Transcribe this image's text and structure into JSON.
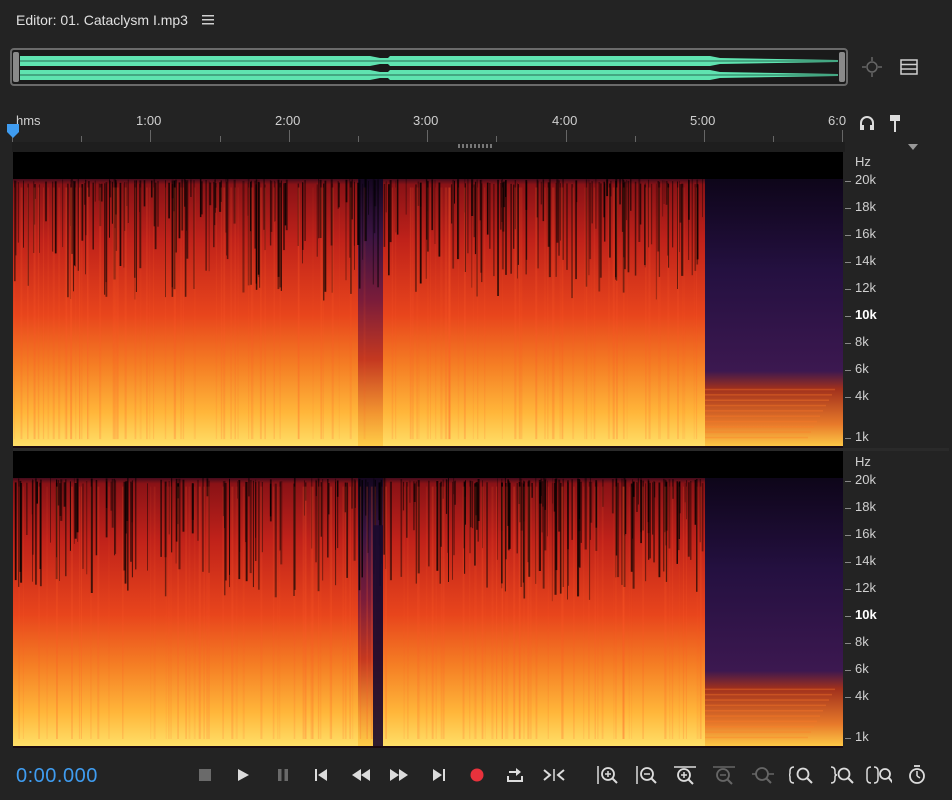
{
  "panel": {
    "title": "Editor: 01. Cataclysm I.mp3",
    "menu_icon": "hamburger-menu-icon"
  },
  "ruler": {
    "unit_label": "hms",
    "time_labels": [
      "1:00",
      "2:00",
      "3:00",
      "4:00",
      "5:00",
      "6:0"
    ]
  },
  "spectrogram": {
    "unit_label": "Hz",
    "channels": [
      {
        "name": "channel-1",
        "freq_labels": [
          "20k",
          "18k",
          "16k",
          "14k",
          "12k",
          "10k",
          "8k",
          "6k",
          "4k",
          "1k"
        ]
      },
      {
        "name": "channel-2",
        "freq_labels": [
          "20k",
          "18k",
          "16k",
          "14k",
          "12k",
          "10k",
          "8k",
          "6k",
          "4k",
          "1k"
        ]
      }
    ]
  },
  "transport": {
    "timecode": "0:00.000",
    "buttons": [
      {
        "name": "stop-button",
        "icon": "stop-icon"
      },
      {
        "name": "play-button",
        "icon": "play-icon"
      },
      {
        "name": "pause-button",
        "icon": "pause-icon"
      },
      {
        "name": "skip-to-start-button",
        "icon": "skip-back-icon"
      },
      {
        "name": "rewind-button",
        "icon": "rewind-icon"
      },
      {
        "name": "fast-forward-button",
        "icon": "fast-forward-icon"
      },
      {
        "name": "skip-to-end-button",
        "icon": "skip-forward-icon"
      },
      {
        "name": "record-button",
        "icon": "record-icon"
      },
      {
        "name": "loop-playback-button",
        "icon": "loop-icon"
      },
      {
        "name": "skip-selection-button",
        "icon": "skip-selection-icon"
      },
      {
        "name": "zoom-in-amplitude-button",
        "icon": "zoom-in-amplitude-icon"
      },
      {
        "name": "zoom-out-amplitude-button",
        "icon": "zoom-out-amplitude-icon"
      },
      {
        "name": "zoom-in-time-button",
        "icon": "zoom-in-time-icon"
      },
      {
        "name": "zoom-out-full-button",
        "icon": "zoom-out-full-icon"
      },
      {
        "name": "zoom-in-selection-button",
        "icon": "zoom-selection-icon"
      },
      {
        "name": "zoom-in-left-button",
        "icon": "zoom-left-icon"
      },
      {
        "name": "zoom-in-right-button",
        "icon": "zoom-right-icon"
      },
      {
        "name": "zoom-both-button",
        "icon": "zoom-both-icon"
      },
      {
        "name": "zoom-reset-button",
        "icon": "zoom-reset-icon"
      }
    ]
  },
  "colors": {
    "accent": "#3f9cf0",
    "waveform": "#5fe3b0",
    "record": "#e8323c",
    "spectro_low": "#1a0a2e",
    "spectro_mid": "#c81f14",
    "spectro_high": "#ffd24a"
  }
}
